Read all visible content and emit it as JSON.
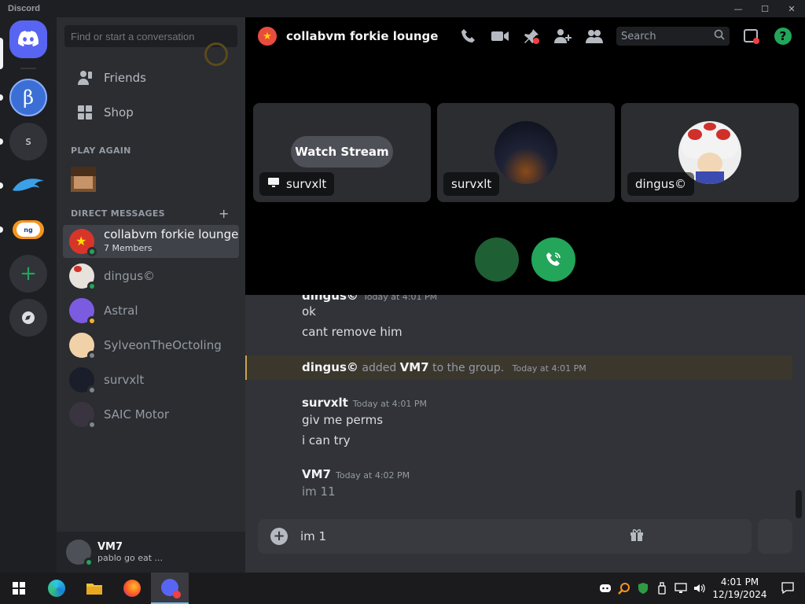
{
  "app": {
    "title": "Discord"
  },
  "window_controls": {
    "minimize": "—",
    "maximize": "☐",
    "close": "✕"
  },
  "sidebar": {
    "search_placeholder": "Find or start a conversation",
    "nav": [
      {
        "label": "Friends"
      },
      {
        "label": "Shop"
      }
    ],
    "play_again_header": "PLAY AGAIN",
    "dm_header": "DIRECT MESSAGES",
    "dm_add": "+",
    "dms": [
      {
        "name": "collabvm forkie lounge",
        "sub": "7 Members",
        "active": true,
        "status": "online"
      },
      {
        "name": "dingus©",
        "status": "online"
      },
      {
        "name": "Astral",
        "status": "idle"
      },
      {
        "name": "SylveonTheOctoling",
        "status": "offline"
      },
      {
        "name": "survxlt",
        "status": "offline"
      },
      {
        "name": "SAIC Motor",
        "status": "offline"
      }
    ],
    "user": {
      "name": "VM7",
      "status": "pablo go eat ..."
    }
  },
  "servers": [
    {
      "icon": "discord-home-icon"
    },
    {
      "icon": "beta-server-icon"
    },
    {
      "label": "s"
    },
    {
      "icon": "dolphin-server-icon"
    },
    {
      "icon": "newgrounds-server-icon"
    },
    {
      "icon": "add-server-icon",
      "label": "+"
    },
    {
      "icon": "discover-icon"
    }
  ],
  "call": {
    "channel_name": "collabvm forkie lounge",
    "search_placeholder": "Search",
    "watch_stream_label": "Watch Stream",
    "tiles": [
      {
        "label": "survxlt"
      },
      {
        "label": "survxlt"
      },
      {
        "label": "dingus©"
      }
    ]
  },
  "chat": {
    "partial_author": "dingus©",
    "partial_time": "Today at 4:01 PM",
    "lines_a": [
      "ok",
      "cant remove him"
    ],
    "system": {
      "actor": "dingus©",
      "verb": "added",
      "target": "VM7",
      "rest": "to the group.",
      "time": "Today at 4:01 PM"
    },
    "msg2": {
      "author": "survxlt",
      "time": "Today at 4:01 PM",
      "lines": [
        "giv me perms",
        "i can try"
      ]
    },
    "msg3": {
      "author": "VM7",
      "time": "Today at 4:02 PM",
      "lines": [
        "im 11"
      ]
    },
    "composer_value": "im 1"
  },
  "taskbar": {
    "time": "4:01 PM",
    "date": "12/19/2024"
  },
  "colors": {
    "accent": "#5865f2",
    "green": "#23a55a",
    "bg": "#313338"
  }
}
